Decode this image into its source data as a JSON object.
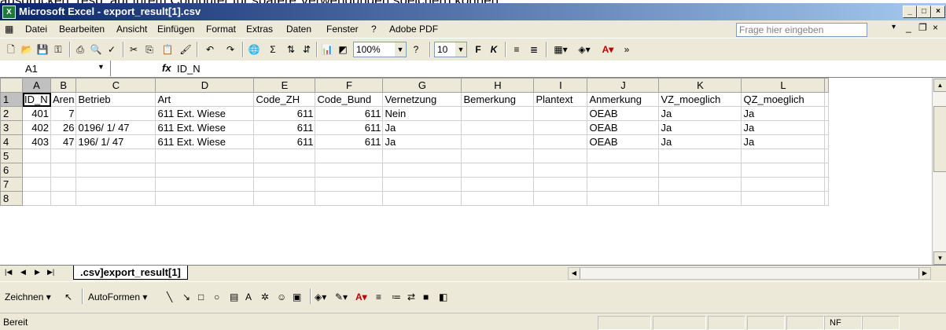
{
  "background_text": "ausdrucken, resp. auf Ihrem Computer für spätere Verwendungen speichern können",
  "window": {
    "title": "Microsoft Excel - export_result[1].csv"
  },
  "menu": {
    "items": [
      "Datei",
      "Bearbeiten",
      "Ansicht",
      "Einfügen",
      "Format",
      "Extras",
      "Daten",
      "Fenster",
      "?",
      "Adobe PDF"
    ],
    "help_placeholder": "Frage hier eingeben"
  },
  "toolbar": {
    "zoom": "100%",
    "font_size": "10",
    "bold": "F",
    "italic": "K"
  },
  "formula": {
    "name_box": "A1",
    "fx": "fx",
    "value": "ID_N"
  },
  "sheet": {
    "columns": [
      "A",
      "B",
      "C",
      "D",
      "E",
      "F",
      "G",
      "H",
      "I",
      "J",
      "K",
      "L"
    ],
    "rows": [
      {
        "n": "1",
        "cells": [
          "ID_N",
          "Aren",
          "Betrieb",
          "Art",
          "Code_ZH",
          "Code_Bund",
          "Vernetzung",
          "Bemerkung",
          "Plantext",
          "Anmerkung",
          "VZ_moeglich",
          "QZ_moeglich"
        ]
      },
      {
        "n": "2",
        "cells": [
          "401",
          "7",
          "",
          " 611 Ext. Wiese",
          "611",
          "611",
          "Nein",
          "",
          "",
          "OEAB",
          "Ja",
          "Ja"
        ]
      },
      {
        "n": "3",
        "cells": [
          "402",
          "26",
          "0196/ 1/ 47",
          " 611 Ext. Wiese",
          "611",
          "611",
          "Ja",
          "",
          "",
          "OEAB",
          "Ja",
          "Ja"
        ]
      },
      {
        "n": "4",
        "cells": [
          "403",
          "47",
          "196/ 1/ 47",
          " 611 Ext. Wiese",
          "611",
          "611",
          "Ja",
          "",
          "",
          "OEAB",
          "Ja",
          "Ja"
        ]
      },
      {
        "n": "5",
        "cells": [
          "",
          "",
          "",
          "",
          "",
          "",
          "",
          "",
          "",
          "",
          "",
          ""
        ]
      },
      {
        "n": "6",
        "cells": [
          "",
          "",
          "",
          "",
          "",
          "",
          "",
          "",
          "",
          "",
          "",
          ""
        ]
      },
      {
        "n": "7",
        "cells": [
          "",
          "",
          "",
          "",
          "",
          "",
          "",
          "",
          "",
          "",
          "",
          ""
        ]
      },
      {
        "n": "8",
        "cells": [
          "",
          "",
          "",
          "",
          "",
          "",
          "",
          "",
          "",
          "",
          "",
          ""
        ]
      }
    ]
  },
  "sheet_tab": {
    "label": ".csv]export_result[1]"
  },
  "drawing": {
    "draw": "Zeichnen",
    "autoshapes": "AutoFormen"
  },
  "status": {
    "text": "Bereit",
    "nf": "NF"
  }
}
